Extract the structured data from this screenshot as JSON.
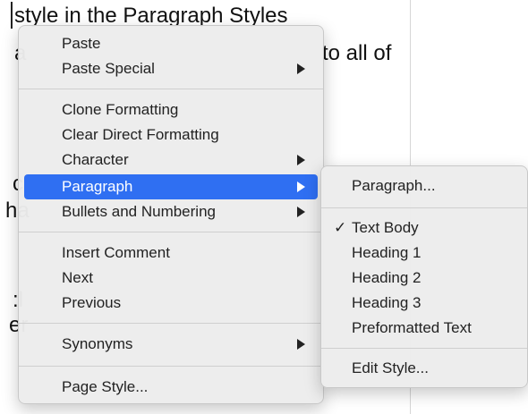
{
  "document": {
    "line1": "style in the Paragraph Styles",
    "line2_left": "a",
    "line2_right": "to all of",
    "frag_c": "c",
    "frag_ha": "ha",
    "frag_cl": ":l",
    "frag_er": "er"
  },
  "context_menu": {
    "items": [
      {
        "label": "Paste"
      },
      {
        "label": "Paste Special"
      },
      {
        "label": "Clone Formatting"
      },
      {
        "label": "Clear Direct Formatting"
      },
      {
        "label": "Character"
      },
      {
        "label": "Paragraph"
      },
      {
        "label": "Bullets and Numbering"
      },
      {
        "label": "Insert Comment"
      },
      {
        "label": "Next"
      },
      {
        "label": "Previous"
      },
      {
        "label": "Synonyms"
      },
      {
        "label": "Page Style..."
      }
    ],
    "active_item": "Paragraph",
    "highlight_color": "#2f6ff2"
  },
  "submenu": {
    "items": [
      {
        "label": "Paragraph..."
      },
      {
        "label": "Text Body",
        "checked": true
      },
      {
        "label": "Heading 1"
      },
      {
        "label": "Heading 2"
      },
      {
        "label": "Heading 3"
      },
      {
        "label": "Preformatted Text"
      },
      {
        "label": "Edit Style..."
      }
    ],
    "check_glyph": "✓"
  }
}
